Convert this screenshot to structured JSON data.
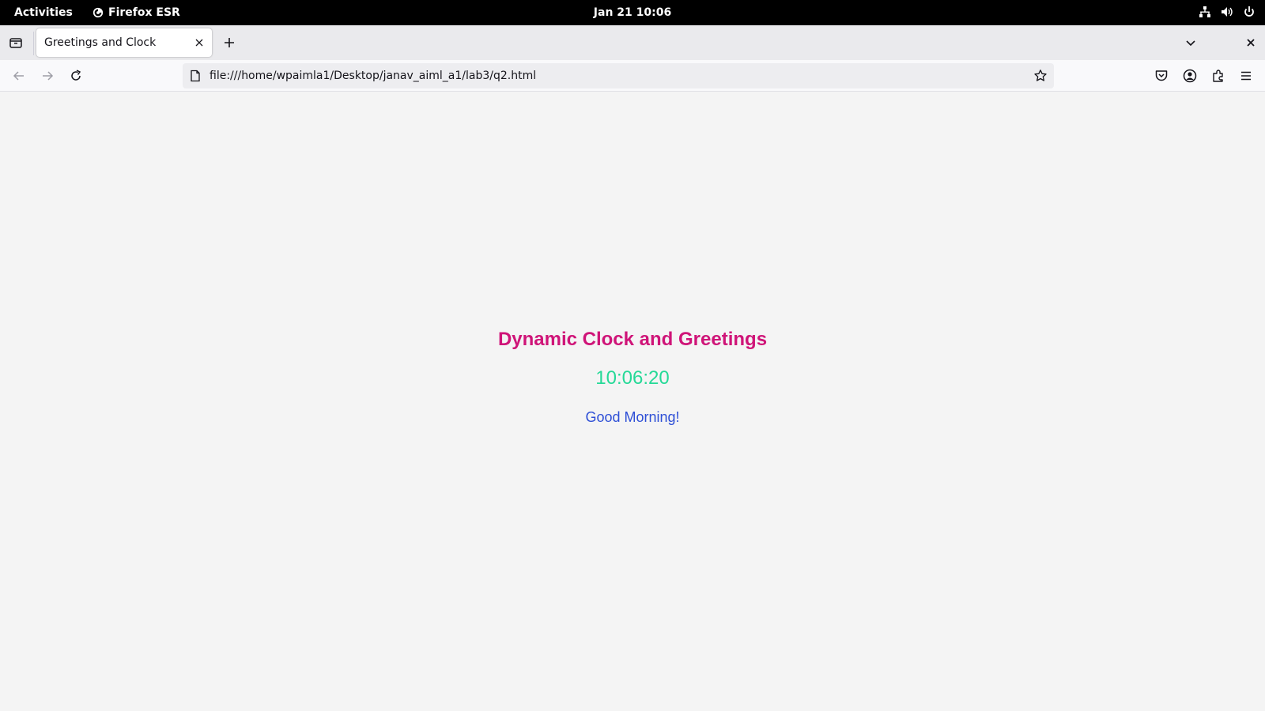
{
  "system_bar": {
    "activities_label": "Activities",
    "app_name": "Firefox ESR",
    "datetime": "Jan 21  10:06",
    "tray_icons": [
      "network-icon",
      "volume-icon",
      "power-icon"
    ]
  },
  "browser": {
    "tabs": [
      {
        "title": "Greetings and Clock",
        "active": true
      }
    ],
    "url": "file:///home/wpaimla1/Desktop/janav_aiml_a1/lab3/q2.html",
    "toolbar_icons": [
      "pocket-icon",
      "account-icon",
      "extensions-icon",
      "menu-icon"
    ]
  },
  "page": {
    "title": "Dynamic Clock and Greetings",
    "time": "10:06:20",
    "greeting": "Good Morning!"
  },
  "colors": {
    "title": "#cf1478",
    "time": "#25d997",
    "greeting": "#2e4fd6",
    "page_background": "#f4f4f4"
  }
}
